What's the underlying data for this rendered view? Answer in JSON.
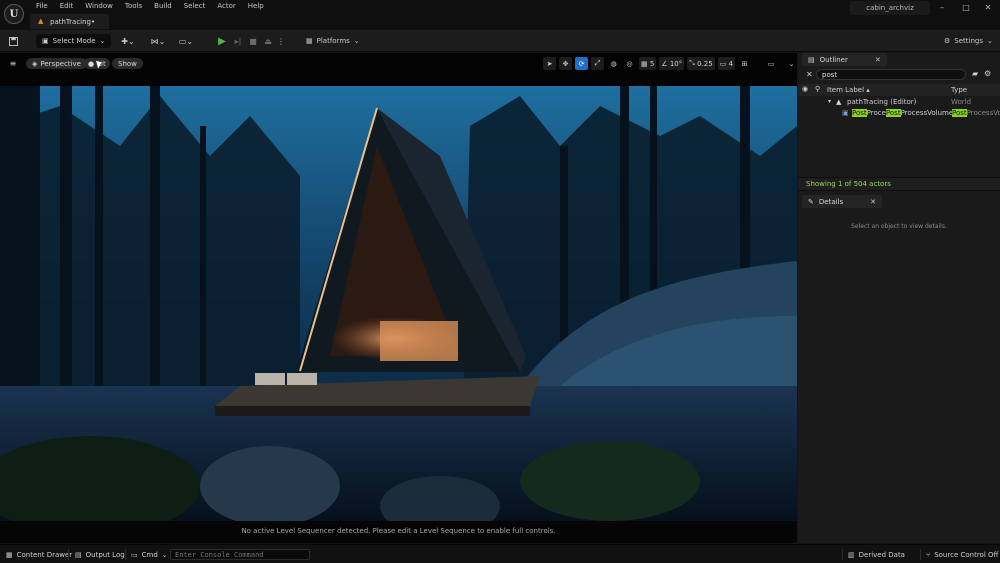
{
  "app": {
    "logo": "U",
    "project_name": "cabin_archviz",
    "tab_title": "pathTracing•",
    "window_controls": [
      "–",
      "□",
      "✕"
    ]
  },
  "menu": {
    "items": [
      "File",
      "Edit",
      "Window",
      "Tools",
      "Build",
      "Select",
      "Actor",
      "Help"
    ]
  },
  "toolbar": {
    "select_mode": "Select Mode",
    "platforms": "Platforms",
    "settings": "Settings"
  },
  "viewport": {
    "menu_icon": "≡",
    "perspective": "Perspective",
    "lit_label": "Lit",
    "show": "Show",
    "grid_snap": "5",
    "rotation_snap": "10°",
    "scale_snap": "0.25",
    "camera_speed": "4",
    "sequencer_message": "No active Level Sequencer detected. Please edit a Level Sequence to enable full controls."
  },
  "outliner": {
    "title": "Outliner",
    "search_value": "post",
    "col_label": "Item Label ▴",
    "col_type": "Type",
    "tree": [
      {
        "label": "pathTracing (Editor)",
        "type": "World"
      },
      {
        "label_parts": [
          "Post",
          "Proce",
          "Post",
          "ProcessVolume"
        ],
        "type_parts": [
          "Post",
          "ProcessVo"
        ]
      }
    ],
    "status": "Showing 1 of 504 actors"
  },
  "details": {
    "title": "Details",
    "empty_message": "Select an object to view details."
  },
  "statusbar": {
    "content_drawer": "Content Drawer",
    "output_log": "Output Log",
    "cmd": "Cmd",
    "console_placeholder": "Enter Console Command",
    "derived_data": "Derived Data",
    "source_control": "Source Control Off"
  },
  "colors": {
    "accent_blue": "#1f6fc9",
    "play_green": "#52b84a",
    "highlight_green": "#8fd11c",
    "status_green": "#9bd64f",
    "tab_orange": "#e08a25"
  }
}
